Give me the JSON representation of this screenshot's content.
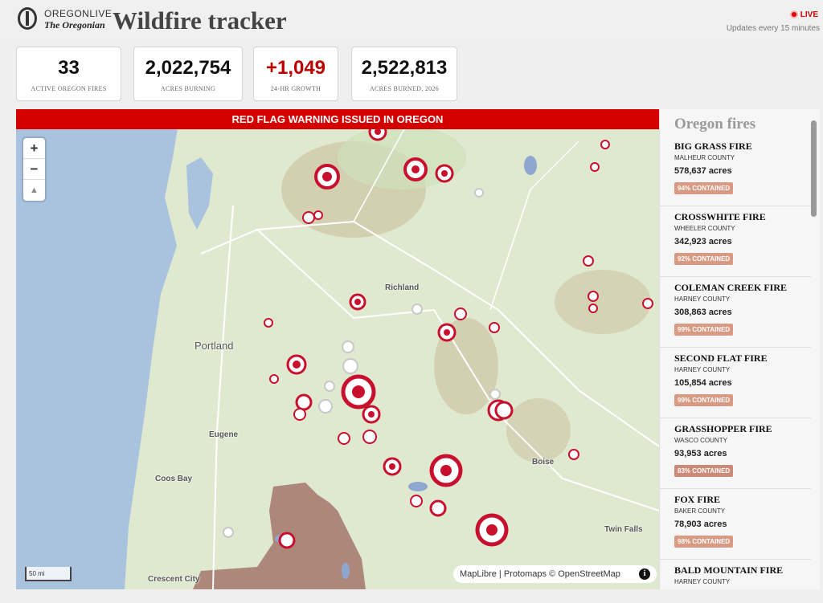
{
  "brand": {
    "top": "OREGONLIVE",
    "bottom": "The Oregonian"
  },
  "title": "Wildfire tracker",
  "live": "LIVE",
  "updates": "Updates every 15 minutes",
  "stats": [
    {
      "value": "33",
      "label": "ACTIVE OREGON FIRES"
    },
    {
      "value": "2,022,754",
      "label": "ACRES BURNING"
    },
    {
      "value": "+1,049",
      "label": "24-HR GROWTH"
    },
    {
      "value": "2,522,813",
      "label": "ACRES BURNED, 2026"
    }
  ],
  "banner": "RED FLAG WARNING ISSUED IN OREGON",
  "map": {
    "zoom_in": "+",
    "zoom_out": "−",
    "compass": "▲",
    "scale": "50 mi",
    "attribution": "MapLibre | Protomaps © OpenStreetMap",
    "info": "i",
    "cities": [
      "Richland",
      "Portland",
      "Eugene",
      "Boise",
      "Coos Bay",
      "Twin Falls",
      "Crescent City"
    ],
    "colors": {
      "water": "#a9c2de",
      "land": "#dfe9cf",
      "fire": "#c8102e",
      "burn": "#a5776b"
    }
  },
  "sidebar": {
    "title": "Oregon fires",
    "fires": [
      {
        "name": "BIG GRASS FIRE",
        "county": "MALHEUR COUNTY",
        "acres": "578,637 acres",
        "contained": "94% CONTAINED"
      },
      {
        "name": "CROSSWHITE FIRE",
        "county": "WHEELER COUNTY",
        "acres": "342,923 acres",
        "contained": "92% CONTAINED"
      },
      {
        "name": "COLEMAN CREEK FIRE",
        "county": "HARNEY COUNTY",
        "acres": "308,863 acres",
        "contained": "99% CONTAINED"
      },
      {
        "name": "SECOND FLAT FIRE",
        "county": "HARNEY COUNTY",
        "acres": "105,854 acres",
        "contained": "99% CONTAINED"
      },
      {
        "name": "GRASSHOPPER FIRE",
        "county": "WASCO COUNTY",
        "acres": "93,953 acres",
        "contained": "83% CONTAINED"
      },
      {
        "name": "FOX FIRE",
        "county": "BAKER COUNTY",
        "acres": "78,903 acres",
        "contained": "98% CONTAINED"
      },
      {
        "name": "BALD MOUNTAIN FIRE",
        "county": "HARNEY COUNTY",
        "acres": "",
        "contained": ""
      }
    ]
  }
}
